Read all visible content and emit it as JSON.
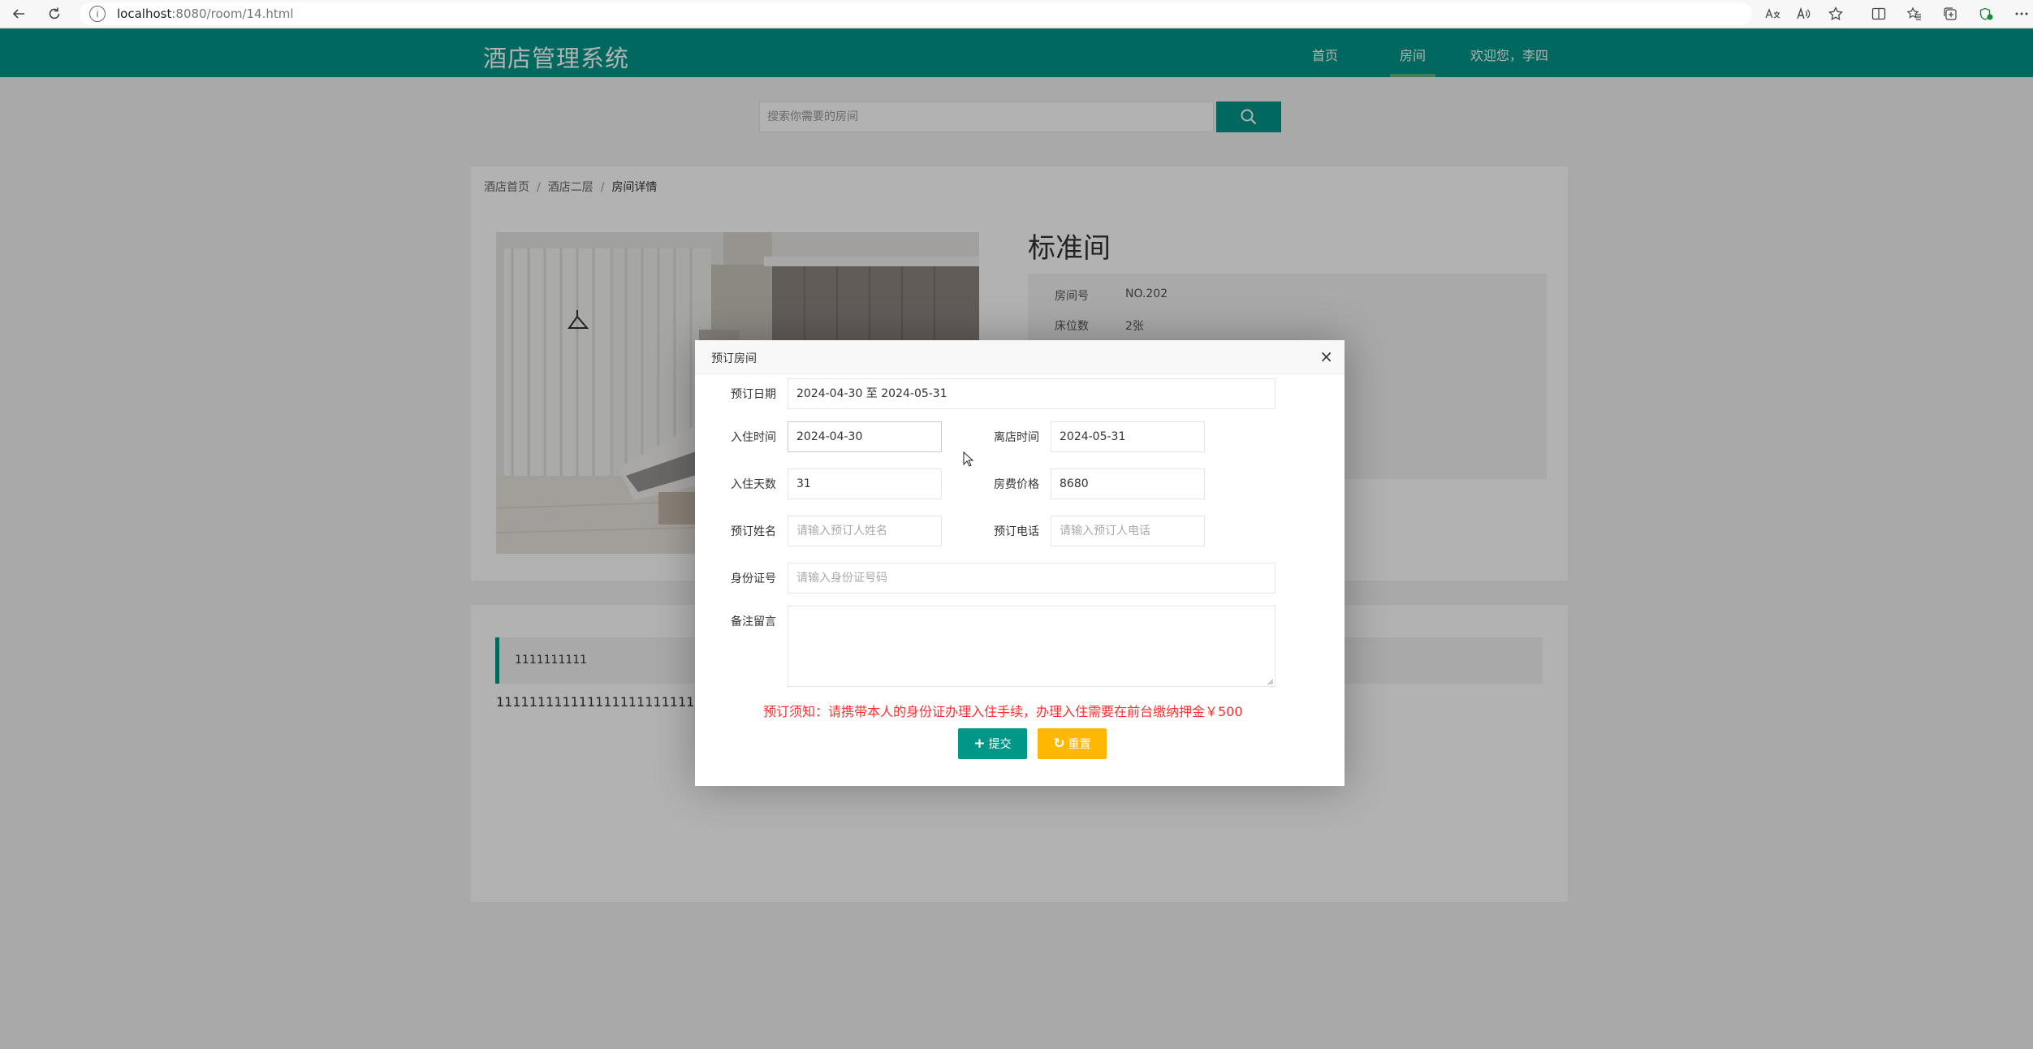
{
  "browser": {
    "url_host": "localhost",
    "url_rest": ":8080/room/14.html",
    "info_glyph": "i"
  },
  "header": {
    "brand": "酒店管理系统",
    "nav": [
      "首页",
      "房间",
      "欢迎您，李四"
    ],
    "active_nav": "房间"
  },
  "search": {
    "placeholder": "搜索你需要的房间"
  },
  "breadcrumb": [
    "酒店首页",
    "酒店二层",
    "房间详情"
  ],
  "breadcrumb_sep": "/",
  "room": {
    "title": "标准间",
    "fields": [
      {
        "label": "房间号",
        "value": "NO.202"
      },
      {
        "label": "床位数",
        "value": "2张"
      }
    ],
    "desc_heading": "1111111111",
    "desc_text": "11111111111111111111111111111111"
  },
  "modal": {
    "title": "预订房间",
    "close": "×",
    "date_range_label": "预订日期",
    "date_range_value": "2024-04-30 至 2024-05-31",
    "checkin_label": "入住时间",
    "checkin_value": "2024-04-30",
    "checkout_label": "离店时间",
    "checkout_value": "2024-05-31",
    "days_label": "入住天数",
    "days_value": "31",
    "price_label": "房费价格",
    "price_value": "8680",
    "name_label": "预订姓名",
    "name_placeholder": "请输入预订人姓名",
    "phone_label": "预订电话",
    "phone_placeholder": "请输入预订人电话",
    "id_label": "身份证号",
    "id_placeholder": "请输入身份证号码",
    "note_label": "备注留言",
    "notice": "预订须知：请携带本人的身份证办理入住手续，办理入住需要在前台缴纳押金￥500",
    "submit": "提交",
    "reset": "重置",
    "submit_icon": "+",
    "reset_icon": "↻"
  },
  "colors": {
    "primary": "#009688",
    "warning": "#ffb800",
    "notice": "#ff2e2e",
    "nav_underline": "#5fb878"
  },
  "icons": [
    "back-arrow-icon",
    "refresh-icon",
    "info-icon",
    "search-icon",
    "close-icon",
    "plus-icon",
    "reset-icon",
    "read-aloud-icon",
    "favorite-star-icon",
    "split-screen-icon",
    "collections-icon",
    "more-icon"
  ]
}
